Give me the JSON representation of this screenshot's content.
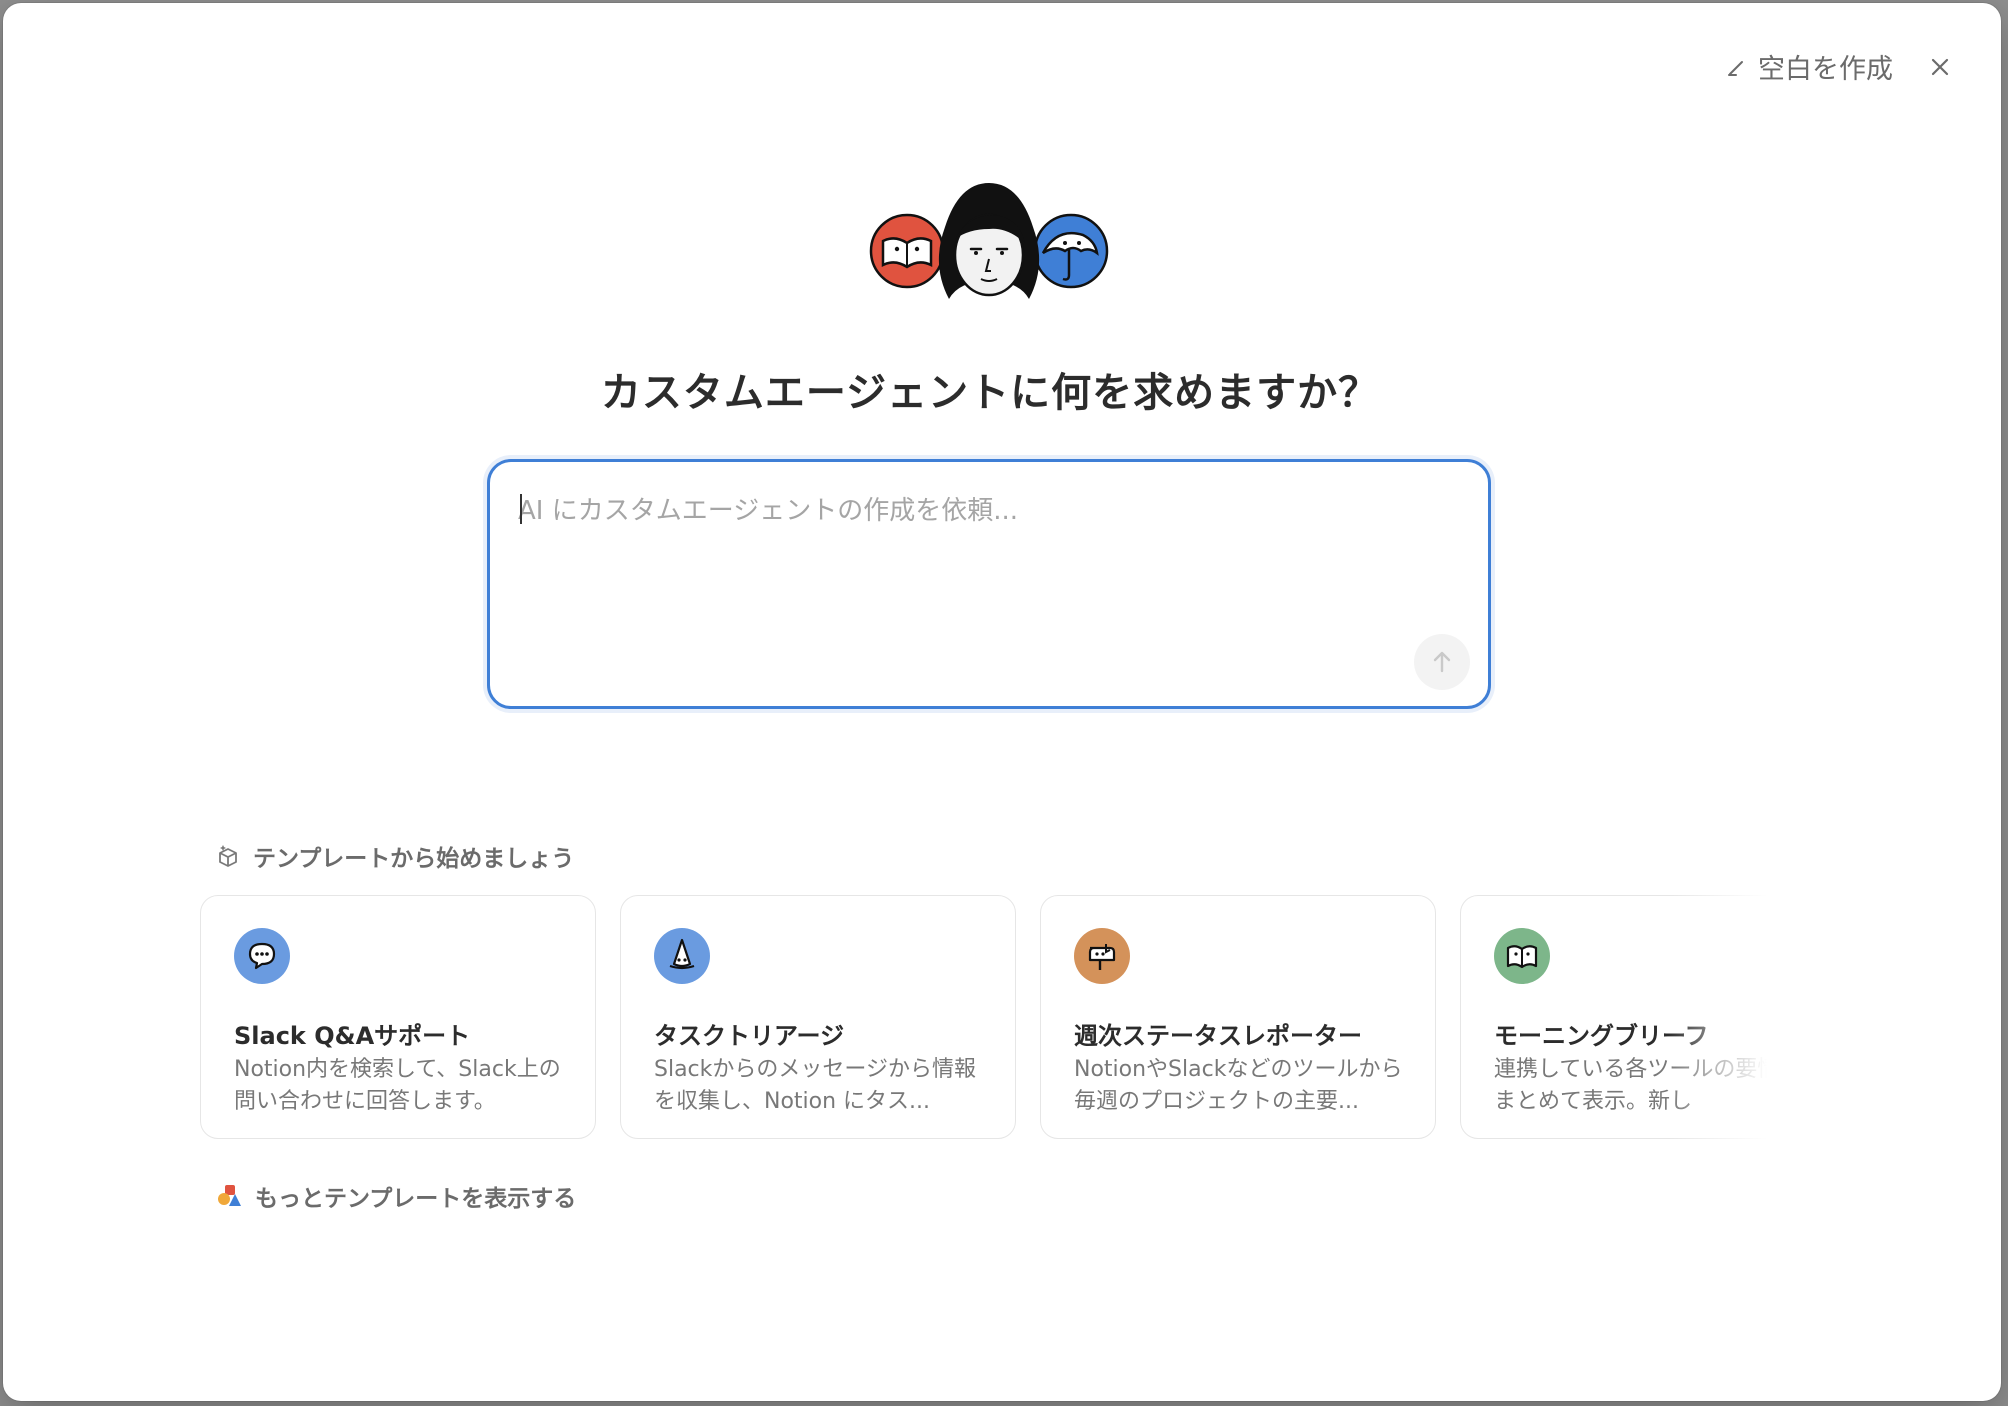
{
  "header": {
    "blank_label": "空白を作成"
  },
  "hero": {
    "headline": "カスタムエージェントに何を求めますか？"
  },
  "prompt": {
    "placeholder": "AI にカスタムエージェントの作成を依頼...",
    "value": ""
  },
  "templates": {
    "section_title": "テンプレートから始めましょう",
    "cards": [
      {
        "title": "Slack Q&Aサポート",
        "description": "Notion内を検索して、Slack上の問い合わせに回答します。",
        "icon": "speech-bubble-icon",
        "color": "#6a9be0"
      },
      {
        "title": "タスクトリアージ",
        "description": "Slackからのメッセージから情報を収集し、Notion にタス...",
        "icon": "wizard-hat-icon",
        "color": "#6a9be0"
      },
      {
        "title": "週次ステータスレポーター",
        "description": "NotionやSlackなどのツールから毎週のプロジェクトの主要...",
        "icon": "mailbox-icon",
        "color": "#d4925a"
      },
      {
        "title": "モーニングブリーフ",
        "description": "連携している各ツールの要情報をまとめて表示。新し",
        "icon": "open-book-icon",
        "color": "#7db68a"
      }
    ],
    "more_label": "もっとテンプレートを表示する"
  },
  "colors": {
    "accent": "#3f7fd6",
    "hero_red": "#e0533f",
    "hero_blue": "#3f7fd6"
  }
}
